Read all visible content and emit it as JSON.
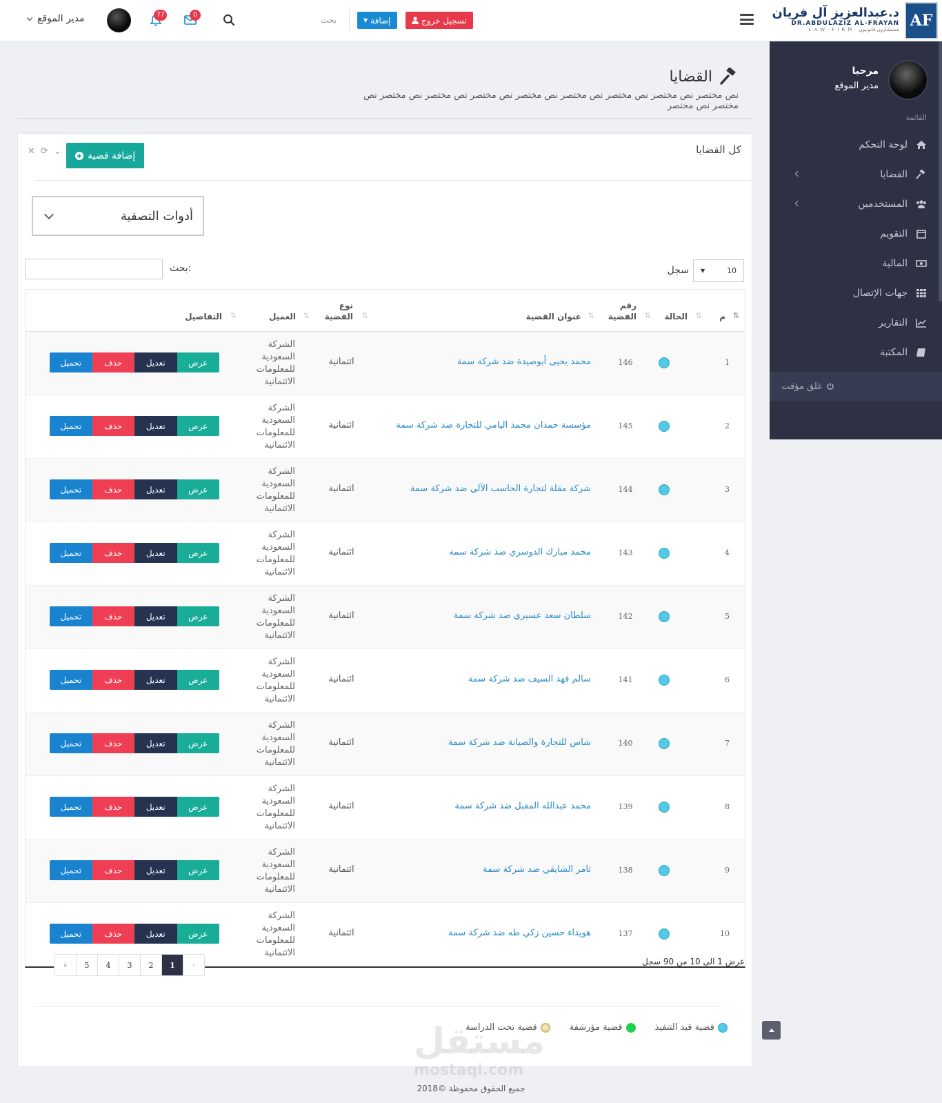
{
  "header": {
    "logo_letters": "AF",
    "logo_ar": "د.عبدالعزيز آل فريان",
    "logo_en": "DR.ABDULAZIZ AL-FRAYAN",
    "logo_sub": "LAW-FIRM  مستشارون قانونيون",
    "logout_label": "تسجيل خروج",
    "add_label": "إضافة",
    "search_placeholder": "بحث",
    "mail_count": "0",
    "notif_count": "77",
    "user_name": "مدير الموقع"
  },
  "sidebar": {
    "hello": "مرحبا",
    "role": "مدير الموقع",
    "menu_title": "القائمة",
    "items": [
      {
        "label": "لوحة التحكم",
        "icon": "home-icon"
      },
      {
        "label": "القضايا",
        "icon": "gavel-icon"
      },
      {
        "label": "المستخدمين",
        "icon": "users-icon"
      },
      {
        "label": "التقويم",
        "icon": "calendar-icon"
      },
      {
        "label": "المالية",
        "icon": "money-icon"
      },
      {
        "label": "جهات الإتصال",
        "icon": "grid-icon"
      },
      {
        "label": "التقارير",
        "icon": "chart-icon"
      },
      {
        "label": "المكتبة",
        "icon": "book-icon"
      }
    ],
    "lock_label": "غلق مؤقت"
  },
  "page": {
    "title": "القضايا",
    "description": "نص مختصر نص مختصر نص مختصر نص مختصر نص مختصر نص مختصر نص مختصر نص مختصر نص مختصر نص مختصر"
  },
  "panel": {
    "title": "كل القضايا",
    "add_case_label": "إضافة قضية",
    "filter_label": "أدوات التصفية",
    "length_value": "10",
    "length_label": "سجل",
    "search_label": "بحث:"
  },
  "table": {
    "headers": {
      "idx": "م",
      "status": "الحالة",
      "number": "رقم القضية",
      "title": "عنوان القضية",
      "type": "نوع القضية",
      "client": "العميل",
      "details": "التفاصيل"
    },
    "buttons": {
      "view": "عرض",
      "edit": "تعديل",
      "delete": "حذف",
      "load": "تحميل"
    },
    "rows": [
      {
        "idx": "1",
        "number": "146",
        "title": "محمد يحيى أبوصيدة ضد شركة سمة",
        "type": "ائتمانية",
        "client": "الشركة السعودية للمعلومات الائتمانية"
      },
      {
        "idx": "2",
        "number": "145",
        "title": "مؤسسة حمدان محمد اليامي للتجارة ضد شركة سمة",
        "type": "ائتمانية",
        "client": "الشركة السعودية للمعلومات الائتمانية"
      },
      {
        "idx": "3",
        "number": "144",
        "title": "شركة مقلة لتجارة الحاسب الآلي ضد شركة سمة",
        "type": "ائتمانية",
        "client": "الشركة السعودية للمعلومات الائتمانية"
      },
      {
        "idx": "4",
        "number": "143",
        "title": "محمد مبارك الدوسري ضد شركة سمة",
        "type": "ائتمانية",
        "client": "الشركة السعودية للمعلومات الائتمانية"
      },
      {
        "idx": "5",
        "number": "142",
        "title": "سلطان سعد عسيري ضد شركة سمة",
        "type": "ائتمانية",
        "client": "الشركة السعودية للمعلومات الائتمانية"
      },
      {
        "idx": "6",
        "number": "141",
        "title": "سالم فهد السيف ضد شركة سمة",
        "type": "ائتمانية",
        "client": "الشركة السعودية للمعلومات الائتمانية"
      },
      {
        "idx": "7",
        "number": "140",
        "title": "شاس للتجارة والصيانة ضد شركة سمة",
        "type": "ائتمانية",
        "client": "الشركة السعودية للمعلومات الائتمانية"
      },
      {
        "idx": "8",
        "number": "139",
        "title": "محمد عبدالله المقبل ضد شركة سمة",
        "type": "ائتمانية",
        "client": "الشركة السعودية للمعلومات الائتمانية"
      },
      {
        "idx": "9",
        "number": "138",
        "title": "ثامر الشايقي ضد شركة سمة",
        "type": "ائتمانية",
        "client": "الشركة السعودية للمعلومات الائتمانية"
      },
      {
        "idx": "10",
        "number": "137",
        "title": "هويداء حسين زكي طه ضد شركة سمة",
        "type": "ائتمانية",
        "client": "الشركة السعودية للمعلومات الائتمانية"
      }
    ]
  },
  "pagination": {
    "info": "عرض 1 الى 10 من 90 سجل",
    "pages": [
      "1",
      "2",
      "3",
      "4",
      "5"
    ],
    "active": "1"
  },
  "legend": [
    {
      "label": "قضية قيد التنفيذ",
      "color": "#54c8e4"
    },
    {
      "label": "قضية مؤرشفة",
      "color": "#22d04a"
    },
    {
      "label": "قضية تحت الدراسة",
      "color": "#f2e2b8"
    }
  ],
  "watermark": {
    "ar": "مستقل",
    "en": "mostaql.com"
  },
  "footer": "2018© جميع الحقوق محفوظة"
}
